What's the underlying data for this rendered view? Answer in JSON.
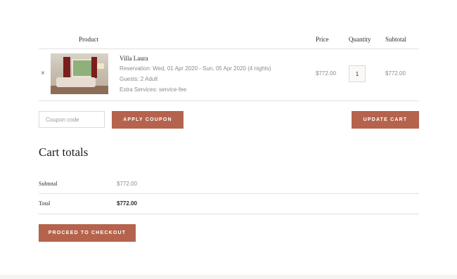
{
  "cart_table": {
    "headers": {
      "product": "Product",
      "price": "Price",
      "quantity": "Quantity",
      "subtotal": "Subtotal"
    },
    "item": {
      "remove": "×",
      "name": "Villa Laura",
      "reservation": "Reservation: Wed, 01 Apr 2020 - Sun, 05 Apr 2020 (4 nights)",
      "guests": "Guests: 2 Adult",
      "extras": "Extra Services: service-fee",
      "price": "$772.00",
      "quantity": "1",
      "subtotal": "$772.00"
    }
  },
  "actions": {
    "coupon_placeholder": "Coupon code",
    "apply_coupon": "APPLY COUPON",
    "update_cart": "UPDATE CART"
  },
  "cart_totals": {
    "title": "Cart totals",
    "subtotal_label": "Subtotal",
    "subtotal_value": "$772.00",
    "total_label": "Total",
    "total_value": "$772.00",
    "checkout": "PROCEED TO CHECKOUT"
  },
  "colors": {
    "accent": "#b5634d",
    "rule": "#e3e1dd"
  }
}
